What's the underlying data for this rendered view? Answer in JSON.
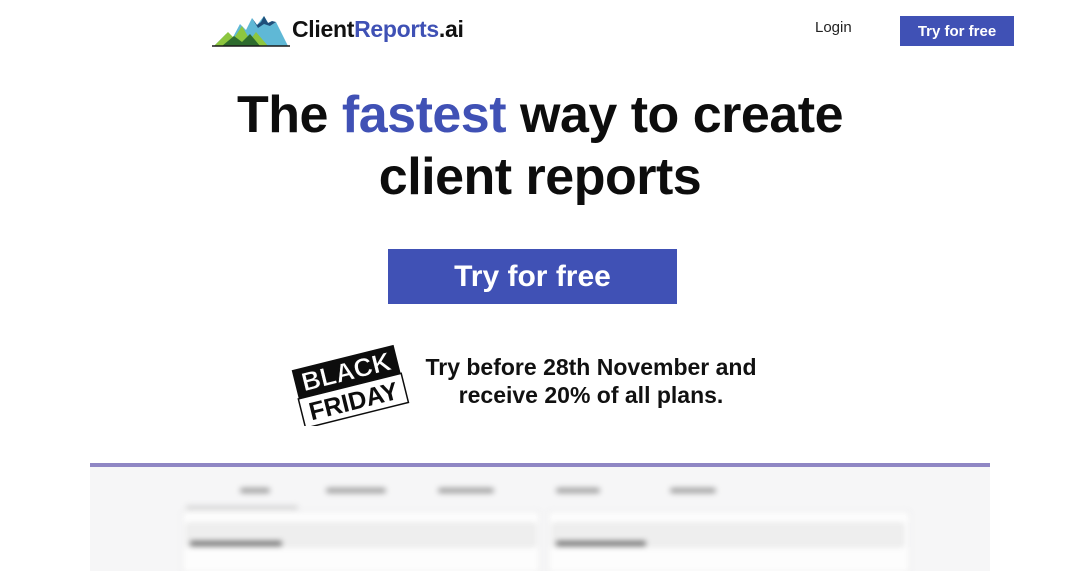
{
  "header": {
    "logo": {
      "name_part1": "Client",
      "name_part2": "Reports",
      "name_part3": ".ai"
    },
    "login_label": "Login",
    "cta_label": "Try for free"
  },
  "hero": {
    "headline_before": "The ",
    "headline_highlight": "fastest",
    "headline_line1_after": " way to create",
    "headline_line2": "client reports",
    "cta_label": "Try for free"
  },
  "promo": {
    "badge_line1": "BLACK",
    "badge_line2": "FRIDAY",
    "text_line1": "Try before 28th November and",
    "text_line2": "receive 20% of all plans."
  },
  "colors": {
    "brand": "#4051b5",
    "text": "#111111",
    "preview_border": "#8f86c4"
  },
  "icons": [
    "mountain-logo-icon"
  ]
}
